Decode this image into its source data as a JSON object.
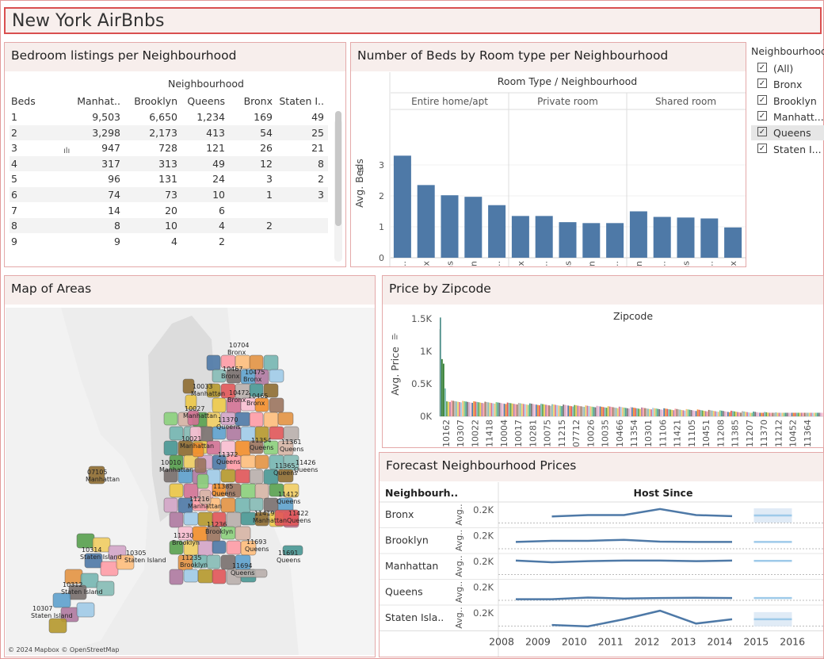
{
  "dashboard_title": "New York AirBnbs",
  "bedrooms_table": {
    "title": "Bedroom listings per Neighbourhood",
    "column_group": "Neighbourhood",
    "row_header": "Beds",
    "columns": [
      "Manhat..",
      "Brooklyn",
      "Queens",
      "Bronx",
      "Staten I.."
    ],
    "rows": [
      {
        "beds": "1",
        "values": [
          "9,503",
          "6,650",
          "1,234",
          "169",
          "49"
        ]
      },
      {
        "beds": "2",
        "values": [
          "3,298",
          "2,173",
          "413",
          "54",
          "25"
        ]
      },
      {
        "beds": "3",
        "values": [
          "947",
          "728",
          "121",
          "26",
          "21"
        ]
      },
      {
        "beds": "4",
        "values": [
          "317",
          "313",
          "49",
          "12",
          "8"
        ]
      },
      {
        "beds": "5",
        "values": [
          "96",
          "131",
          "24",
          "3",
          "2"
        ]
      },
      {
        "beds": "6",
        "values": [
          "74",
          "73",
          "10",
          "1",
          "3"
        ]
      },
      {
        "beds": "7",
        "values": [
          "14",
          "20",
          "6",
          "",
          ""
        ]
      },
      {
        "beds": "8",
        "values": [
          "8",
          "10",
          "4",
          "2",
          ""
        ]
      },
      {
        "beds": "9",
        "values": [
          "9",
          "4",
          "2",
          "",
          ""
        ]
      }
    ]
  },
  "legend": {
    "title": "Neighbourhood",
    "items": [
      {
        "label": "(All)",
        "selected": false
      },
      {
        "label": "Bronx",
        "selected": false
      },
      {
        "label": "Brooklyn",
        "selected": false
      },
      {
        "label": "Manhatt...",
        "selected": false
      },
      {
        "label": "Queens",
        "selected": true
      },
      {
        "label": "Staten I...",
        "selected": false
      }
    ]
  },
  "map": {
    "title": "Map of Areas",
    "credit": "© 2024 Mapbox © OpenStreetMap",
    "labels": [
      {
        "zip": "10704",
        "area": "Bronx"
      },
      {
        "zip": "10467",
        "area": "Bronx"
      },
      {
        "zip": "10475",
        "area": "Bronx"
      },
      {
        "zip": "10033",
        "area": "Manhattan"
      },
      {
        "zip": "10472",
        "area": "Bronx"
      },
      {
        "zip": "10465",
        "area": "Bronx"
      },
      {
        "zip": "10027",
        "area": "Manhattan"
      },
      {
        "zip": "11370",
        "area": "Queens"
      },
      {
        "zip": "10021",
        "area": "Manhattan"
      },
      {
        "zip": "11354",
        "area": "Queens"
      },
      {
        "zip": "11361",
        "area": "Queens"
      },
      {
        "zip": "11372",
        "area": "Queens"
      },
      {
        "zip": "10010",
        "area": "Manhattan"
      },
      {
        "zip": "11365",
        "area": "Queens"
      },
      {
        "zip": "11426",
        "area": "Queens"
      },
      {
        "zip": "07105",
        "area": "Manhattan"
      },
      {
        "zip": "11385",
        "area": "Queens"
      },
      {
        "zip": "11216",
        "area": "Manhattan"
      },
      {
        "zip": "11419",
        "area": "Manhattan"
      },
      {
        "zip": "11412",
        "area": "Queens"
      },
      {
        "zip": "11422",
        "area": "Queens"
      },
      {
        "zip": "11236",
        "area": "Brooklyn"
      },
      {
        "zip": "11230",
        "area": "Brooklyn"
      },
      {
        "zip": "11693",
        "area": "Queens"
      },
      {
        "zip": "11691",
        "area": "Queens"
      },
      {
        "zip": "10314",
        "area": "Staten Island"
      },
      {
        "zip": "10305",
        "area": "Staten Island"
      },
      {
        "zip": "11235",
        "area": "Brooklyn"
      },
      {
        "zip": "11694",
        "area": "Queens"
      },
      {
        "zip": "10312",
        "area": "Staten Island"
      },
      {
        "zip": "10307",
        "area": "Staten Island"
      }
    ]
  },
  "chart_data": [
    {
      "type": "bar",
      "title": "Number of Beds by Room type per Neighbourhood",
      "column_header": "Room Type / Neighbourhood",
      "ylabel": "Avg. Beds",
      "ylim": [
        0,
        3.5
      ],
      "yticks": [
        "0",
        "1",
        "2",
        "3"
      ],
      "color": "#4e79a7",
      "groups": [
        {
          "name": "Entire home/apt",
          "categories": [
            "Staten I..",
            "Bronx",
            "Queens",
            "Brooklyn",
            "Manhat.."
          ],
          "values": [
            3.3,
            2.35,
            2.02,
            1.97,
            1.7
          ]
        },
        {
          "name": "Private room",
          "categories": [
            "Bronx",
            "Staten I..",
            "Queens",
            "Brooklyn",
            "Manhat.."
          ],
          "values": [
            1.35,
            1.35,
            1.15,
            1.12,
            1.12
          ]
        },
        {
          "name": "Shared room",
          "categories": [
            "Brooklyn",
            "Staten I..",
            "Queens",
            "Manhat..",
            "Bronx"
          ],
          "values": [
            1.5,
            1.32,
            1.3,
            1.27,
            0.98
          ]
        }
      ]
    },
    {
      "type": "bar",
      "title": "Price by Zipcode",
      "column_header": "Zipcode",
      "ylabel": "Avg. Price",
      "yticks": [
        "0K",
        "0.5K",
        "1K",
        "1.5K"
      ],
      "ylim": [
        0,
        1600
      ],
      "x_labels": [
        "10162",
        "10307",
        "10022",
        "11418",
        "10004",
        "10017",
        "10281",
        "10075",
        "11215",
        "07712",
        "10026",
        "10035",
        "10466",
        "11354",
        "10301",
        "11106",
        "11421",
        "11105",
        "10451",
        "11208",
        "11385",
        "11207",
        "11370",
        "11212",
        "10452",
        "11364"
      ]
    },
    {
      "type": "line",
      "title": "Forecast Neighbourhood Prices",
      "row_header": "Neighbourh..",
      "column_header": "Host Since",
      "x": [
        "2008",
        "2009",
        "2010",
        "2011",
        "2012",
        "2013",
        "2014",
        "2015",
        "2016"
      ],
      "ylabel": "Avg..",
      "ytick": "0.2K",
      "color": "#4e79a7",
      "forecast_color": "#9ecae9",
      "series": [
        {
          "name": "Bronx",
          "values": [
            null,
            148,
            158,
            158,
            200,
            158,
            150
          ],
          "forecast": [
            155,
            155
          ]
        },
        {
          "name": "Brooklyn",
          "values": [
            150,
            158,
            158,
            165,
            152,
            150,
            150
          ],
          "forecast": [
            150,
            150
          ]
        },
        {
          "name": "Manhattan",
          "values": [
            200,
            188,
            196,
            200,
            200,
            196,
            200
          ],
          "forecast": [
            198,
            198
          ]
        },
        {
          "name": "Queens",
          "values": [
            110,
            110,
            122,
            115,
            118,
            120,
            118
          ],
          "forecast": [
            118,
            118
          ]
        },
        {
          "name": "Staten Isla..",
          "values": [
            null,
            110,
            100,
            150,
            210,
            120,
            150
          ],
          "forecast": [
            150,
            150
          ]
        }
      ]
    }
  ]
}
